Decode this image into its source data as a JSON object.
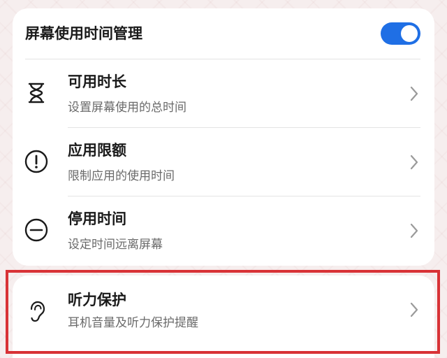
{
  "screen_time": {
    "title": "屏幕使用时间管理",
    "toggle_on": true,
    "items": [
      {
        "title": "可用时长",
        "subtitle": "设置屏幕使用的总时间",
        "icon": "hourglass-icon"
      },
      {
        "title": "应用限额",
        "subtitle": "限制应用的使用时间",
        "icon": "exclamation-circle-icon"
      },
      {
        "title": "停用时间",
        "subtitle": "设定时间远离屏幕",
        "icon": "minus-circle-icon"
      }
    ]
  },
  "hearing": {
    "title": "听力保护",
    "subtitle": "耳机音量及听力保护提醒",
    "icon": "ear-icon"
  },
  "colors": {
    "toggle_accent": "#1f6fe5",
    "highlight_border": "#d83236"
  }
}
